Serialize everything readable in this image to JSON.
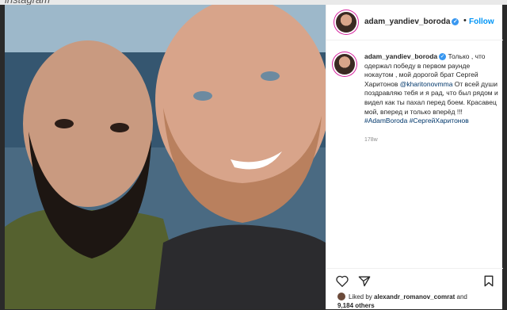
{
  "watermark": "instagram",
  "post": {
    "username": "adam_yandiev_boroda",
    "verified_mark": "✓",
    "follow_label": "Follow",
    "caption_user": "adam_yandiev_boroda",
    "caption_text": " Только , что одержал победу в первом раунде нокаутом , мой дорогой брат Сергей Харитонов ",
    "mention": "@kharitonovmma",
    "caption_text2": " От всей души поздравляю тебя и я рад, что был рядом и видел как ты пахал перед боем. Красавец мой, вперед и только вперёд !!! ",
    "hashtags": "#AdamBoroda #СергейХаритонов",
    "time_ago": "178w",
    "likes_prefix": "Liked by ",
    "liked_by": "alexandr_romanov_comrat",
    "likes_and": " and",
    "likes_count": "9,184 others"
  },
  "icons": [
    "heart-icon",
    "share-icon",
    "bookmark-icon"
  ],
  "colors": {
    "link": "#00376b",
    "follow": "#0095f6",
    "verified": "#3897f0"
  }
}
